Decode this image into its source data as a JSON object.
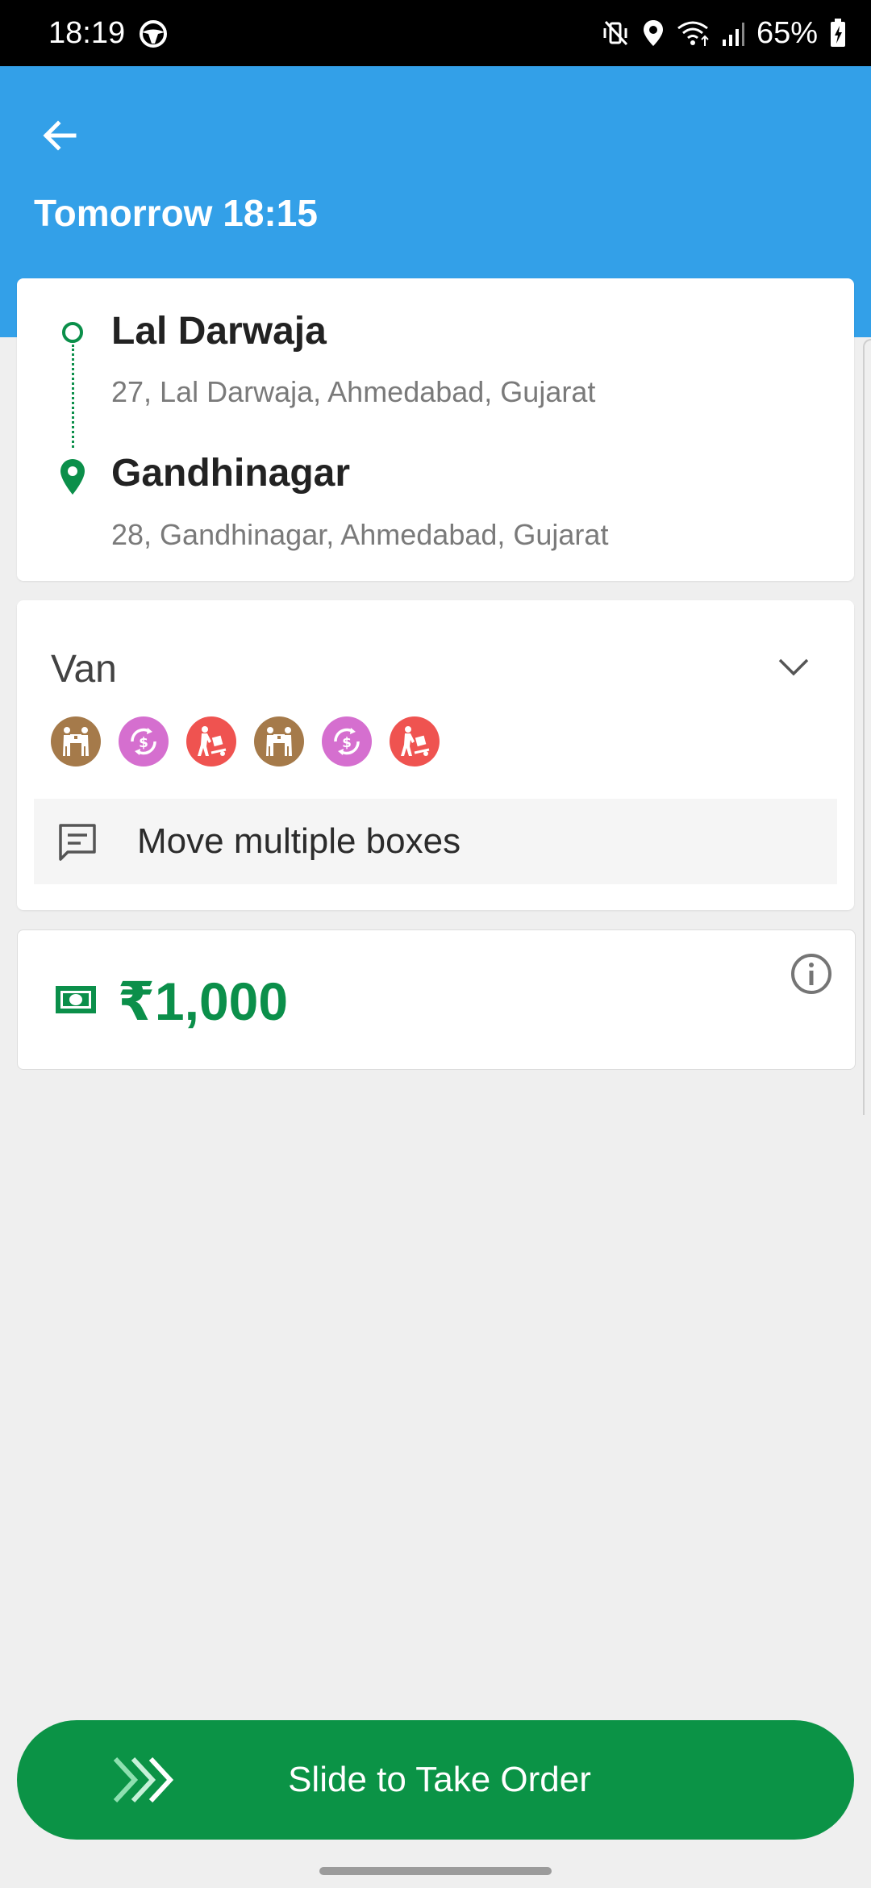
{
  "status_bar": {
    "time": "18:19",
    "battery": "65%",
    "icons": [
      "steering-wheel-icon",
      "mute-vibrate-icon",
      "location-icon",
      "wifi-icon",
      "signal-icon",
      "battery-charging-icon"
    ]
  },
  "header": {
    "back_icon": "arrow-left-icon",
    "title": "Tomorrow 18:15"
  },
  "route": {
    "pickup": {
      "name": "Lal Darwaja",
      "address": "27, Lal Darwaja, Ahmedabad, Gujarat"
    },
    "dropoff": {
      "name": "Gandhinagar",
      "address": "28, Gandhinagar, Ahmedabad, Gujarat"
    }
  },
  "vehicle": {
    "name": "Van",
    "services": [
      {
        "icon": "movers-icon",
        "color": "#a57a4a"
      },
      {
        "icon": "cash-exchange-icon",
        "color": "#d56fcf"
      },
      {
        "icon": "trolley-icon",
        "color": "#ef5350"
      },
      {
        "icon": "movers-icon",
        "color": "#a57a4a"
      },
      {
        "icon": "cash-exchange-icon",
        "color": "#d56fcf"
      },
      {
        "icon": "trolley-icon",
        "color": "#ef5350"
      }
    ],
    "note": "Move multiple boxes"
  },
  "price": {
    "amount": "₹1,000"
  },
  "slide_button": {
    "label": "Slide to Take Order"
  },
  "colors": {
    "header": "#33a0e8",
    "accent_green": "#0b8f4a",
    "background": "#efefef"
  }
}
